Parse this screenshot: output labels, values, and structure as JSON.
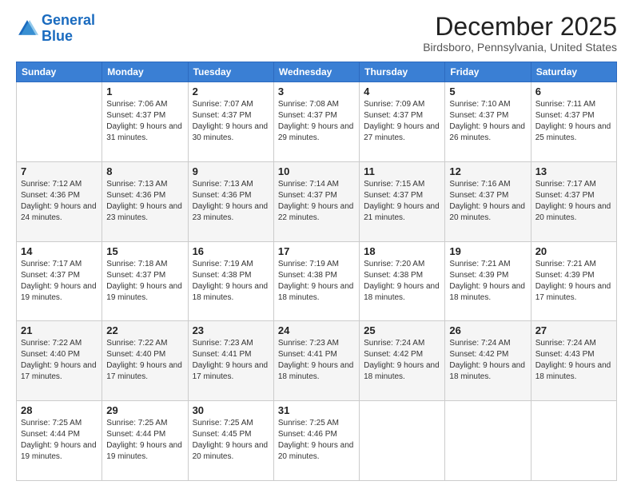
{
  "logo": {
    "line1": "General",
    "line2": "Blue"
  },
  "header": {
    "month": "December 2025",
    "location": "Birdsboro, Pennsylvania, United States"
  },
  "weekdays": [
    "Sunday",
    "Monday",
    "Tuesday",
    "Wednesday",
    "Thursday",
    "Friday",
    "Saturday"
  ],
  "weeks": [
    [
      {
        "day": "",
        "sunrise": "",
        "sunset": "",
        "daylight": ""
      },
      {
        "day": "1",
        "sunrise": "Sunrise: 7:06 AM",
        "sunset": "Sunset: 4:37 PM",
        "daylight": "Daylight: 9 hours and 31 minutes."
      },
      {
        "day": "2",
        "sunrise": "Sunrise: 7:07 AM",
        "sunset": "Sunset: 4:37 PM",
        "daylight": "Daylight: 9 hours and 30 minutes."
      },
      {
        "day": "3",
        "sunrise": "Sunrise: 7:08 AM",
        "sunset": "Sunset: 4:37 PM",
        "daylight": "Daylight: 9 hours and 29 minutes."
      },
      {
        "day": "4",
        "sunrise": "Sunrise: 7:09 AM",
        "sunset": "Sunset: 4:37 PM",
        "daylight": "Daylight: 9 hours and 27 minutes."
      },
      {
        "day": "5",
        "sunrise": "Sunrise: 7:10 AM",
        "sunset": "Sunset: 4:37 PM",
        "daylight": "Daylight: 9 hours and 26 minutes."
      },
      {
        "day": "6",
        "sunrise": "Sunrise: 7:11 AM",
        "sunset": "Sunset: 4:37 PM",
        "daylight": "Daylight: 9 hours and 25 minutes."
      }
    ],
    [
      {
        "day": "7",
        "sunrise": "Sunrise: 7:12 AM",
        "sunset": "Sunset: 4:36 PM",
        "daylight": "Daylight: 9 hours and 24 minutes."
      },
      {
        "day": "8",
        "sunrise": "Sunrise: 7:13 AM",
        "sunset": "Sunset: 4:36 PM",
        "daylight": "Daylight: 9 hours and 23 minutes."
      },
      {
        "day": "9",
        "sunrise": "Sunrise: 7:13 AM",
        "sunset": "Sunset: 4:36 PM",
        "daylight": "Daylight: 9 hours and 23 minutes."
      },
      {
        "day": "10",
        "sunrise": "Sunrise: 7:14 AM",
        "sunset": "Sunset: 4:37 PM",
        "daylight": "Daylight: 9 hours and 22 minutes."
      },
      {
        "day": "11",
        "sunrise": "Sunrise: 7:15 AM",
        "sunset": "Sunset: 4:37 PM",
        "daylight": "Daylight: 9 hours and 21 minutes."
      },
      {
        "day": "12",
        "sunrise": "Sunrise: 7:16 AM",
        "sunset": "Sunset: 4:37 PM",
        "daylight": "Daylight: 9 hours and 20 minutes."
      },
      {
        "day": "13",
        "sunrise": "Sunrise: 7:17 AM",
        "sunset": "Sunset: 4:37 PM",
        "daylight": "Daylight: 9 hours and 20 minutes."
      }
    ],
    [
      {
        "day": "14",
        "sunrise": "Sunrise: 7:17 AM",
        "sunset": "Sunset: 4:37 PM",
        "daylight": "Daylight: 9 hours and 19 minutes."
      },
      {
        "day": "15",
        "sunrise": "Sunrise: 7:18 AM",
        "sunset": "Sunset: 4:37 PM",
        "daylight": "Daylight: 9 hours and 19 minutes."
      },
      {
        "day": "16",
        "sunrise": "Sunrise: 7:19 AM",
        "sunset": "Sunset: 4:38 PM",
        "daylight": "Daylight: 9 hours and 18 minutes."
      },
      {
        "day": "17",
        "sunrise": "Sunrise: 7:19 AM",
        "sunset": "Sunset: 4:38 PM",
        "daylight": "Daylight: 9 hours and 18 minutes."
      },
      {
        "day": "18",
        "sunrise": "Sunrise: 7:20 AM",
        "sunset": "Sunset: 4:38 PM",
        "daylight": "Daylight: 9 hours and 18 minutes."
      },
      {
        "day": "19",
        "sunrise": "Sunrise: 7:21 AM",
        "sunset": "Sunset: 4:39 PM",
        "daylight": "Daylight: 9 hours and 18 minutes."
      },
      {
        "day": "20",
        "sunrise": "Sunrise: 7:21 AM",
        "sunset": "Sunset: 4:39 PM",
        "daylight": "Daylight: 9 hours and 17 minutes."
      }
    ],
    [
      {
        "day": "21",
        "sunrise": "Sunrise: 7:22 AM",
        "sunset": "Sunset: 4:40 PM",
        "daylight": "Daylight: 9 hours and 17 minutes."
      },
      {
        "day": "22",
        "sunrise": "Sunrise: 7:22 AM",
        "sunset": "Sunset: 4:40 PM",
        "daylight": "Daylight: 9 hours and 17 minutes."
      },
      {
        "day": "23",
        "sunrise": "Sunrise: 7:23 AM",
        "sunset": "Sunset: 4:41 PM",
        "daylight": "Daylight: 9 hours and 17 minutes."
      },
      {
        "day": "24",
        "sunrise": "Sunrise: 7:23 AM",
        "sunset": "Sunset: 4:41 PM",
        "daylight": "Daylight: 9 hours and 18 minutes."
      },
      {
        "day": "25",
        "sunrise": "Sunrise: 7:24 AM",
        "sunset": "Sunset: 4:42 PM",
        "daylight": "Daylight: 9 hours and 18 minutes."
      },
      {
        "day": "26",
        "sunrise": "Sunrise: 7:24 AM",
        "sunset": "Sunset: 4:42 PM",
        "daylight": "Daylight: 9 hours and 18 minutes."
      },
      {
        "day": "27",
        "sunrise": "Sunrise: 7:24 AM",
        "sunset": "Sunset: 4:43 PM",
        "daylight": "Daylight: 9 hours and 18 minutes."
      }
    ],
    [
      {
        "day": "28",
        "sunrise": "Sunrise: 7:25 AM",
        "sunset": "Sunset: 4:44 PM",
        "daylight": "Daylight: 9 hours and 19 minutes."
      },
      {
        "day": "29",
        "sunrise": "Sunrise: 7:25 AM",
        "sunset": "Sunset: 4:44 PM",
        "daylight": "Daylight: 9 hours and 19 minutes."
      },
      {
        "day": "30",
        "sunrise": "Sunrise: 7:25 AM",
        "sunset": "Sunset: 4:45 PM",
        "daylight": "Daylight: 9 hours and 20 minutes."
      },
      {
        "day": "31",
        "sunrise": "Sunrise: 7:25 AM",
        "sunset": "Sunset: 4:46 PM",
        "daylight": "Daylight: 9 hours and 20 minutes."
      },
      {
        "day": "",
        "sunrise": "",
        "sunset": "",
        "daylight": ""
      },
      {
        "day": "",
        "sunrise": "",
        "sunset": "",
        "daylight": ""
      },
      {
        "day": "",
        "sunrise": "",
        "sunset": "",
        "daylight": ""
      }
    ]
  ]
}
